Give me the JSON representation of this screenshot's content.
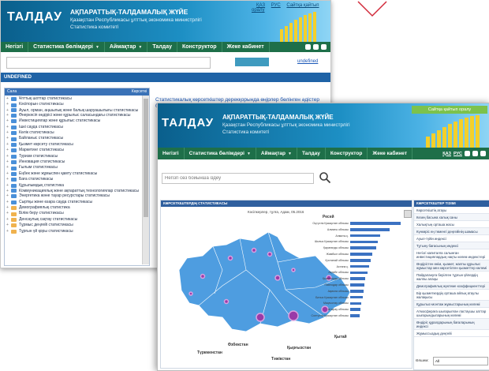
{
  "back": {
    "logo": "ТАЛДАУ",
    "title": "АҚПАРАТТЫҚ-ТАЛДАМАЛЫҚ ЖҮЙЕ",
    "subtitle_line1": "Қазақстан Республикасы ұлттық экономика министрлігі",
    "subtitle_line2": "Статистика комитеті",
    "top_links": [
      "ҚАЗ",
      "РУС",
      "Сайтқа қайтып оралу"
    ],
    "nav": [
      {
        "label": "Негізгі",
        "caret": false
      },
      {
        "label": "Статистика бөлімдері",
        "caret": true
      },
      {
        "label": "Аймақтар",
        "caret": true
      },
      {
        "label": "Талдау",
        "caret": false
      },
      {
        "label": "Конструктор",
        "caret": false
      },
      {
        "label": "Жеке кабинет",
        "caret": false
      }
    ],
    "search_link": "undefined",
    "section": "UNDEFINED",
    "tree_header_left": "Сала",
    "tree_header_right": "Көрсеткі",
    "tree_items": [
      {
        "label": "Ұлттық шоттар статистикасы",
        "color": "blue"
      },
      {
        "label": "Кәсіпорын статистикасы",
        "color": "blue"
      },
      {
        "label": "Ауыл, орман, аңшылық және балық шаруашылығы статистикасы",
        "color": "blue",
        "wrap": true
      },
      {
        "label": "Өнеркәсіп өндірісі және құрылыс саласындағы статистикасы",
        "color": "blue"
      },
      {
        "label": "Инвестициялар және құрылыс статистикасы",
        "color": "blue"
      },
      {
        "label": "Ішкі сауда статистикасы",
        "color": "blue"
      },
      {
        "label": "Көлік статистикасы",
        "color": "blue"
      },
      {
        "label": "Байланыс статистикасы",
        "color": "blue"
      },
      {
        "label": "Қызмет көрсету статистикасы",
        "color": "blue"
      },
      {
        "label": "Маркетинг статистикасы",
        "color": "blue"
      },
      {
        "label": "Туризм статистикасы",
        "color": "blue"
      },
      {
        "label": "Инновация статистикасы",
        "color": "blue"
      },
      {
        "label": "Ғылым статистикасы",
        "color": "blue"
      },
      {
        "label": "Еңбек және жұмыспен қамту статистикасы",
        "color": "blue"
      },
      {
        "label": "Баға статистикасы",
        "color": "blue"
      },
      {
        "label": "Құрылымдық статистика",
        "color": "blue"
      },
      {
        "label": "Коммуникациялық және ақпараттық технологиялар статистикасы",
        "color": "blue",
        "wrap": true
      },
      {
        "label": "Энергетика және тауар ресурстары статистикасы",
        "color": "blue"
      },
      {
        "label": "Сыртқы және өзара сауда статистикасы",
        "color": "blue"
      },
      {
        "label": "Демографиялық статистика",
        "color": "orange"
      },
      {
        "label": "Білім беру статистикасы",
        "color": "orange"
      },
      {
        "label": "Денсаулық сақтау статистикасы",
        "color": "orange"
      },
      {
        "label": "Тұрмыс деңгейі статистикасы",
        "color": "orange"
      },
      {
        "label": "Тұрғын үй қоры статистикасы",
        "color": "orange"
      }
    ],
    "info_text": "Статистикалық көрсеткіштер дерекқорында өңірлер бөлінген әдістер бойынша деректер жоқ"
  },
  "front": {
    "logo": "ТАЛДАУ",
    "title": "АҚПАРАТТЫҚ-ТАЛДАМАЛЫҚ ЖҮЙЕ",
    "subtitle_line1": "Қазақстан Республикасы ұлттық экономика министрлігі",
    "subtitle_line2": "Статистика комитеті",
    "top_link": "Сайтқа қайтып оралу",
    "lang_links": [
      "ҚАЗ",
      "РУС"
    ],
    "nav": [
      {
        "label": "Негізгі",
        "caret": false
      },
      {
        "label": "Статистика бөлімдері",
        "caret": true
      },
      {
        "label": "Аймақтар",
        "caret": true
      },
      {
        "label": "Талдау",
        "caret": false
      },
      {
        "label": "Конструктор",
        "caret": false
      },
      {
        "label": "Жеке кабинет",
        "caret": false
      }
    ],
    "search_placeholder": "Негізгі сөз бойынша іздеу",
    "map_panel_title": "КӨРСЕТКІШТЕРДІҢ СТАТИСТИКАСЫ",
    "chart_title": "Кәсіпкерлер, тұлға, Адам, 05.2016",
    "map_labels": {
      "russia": "Ресей",
      "uzbekistan": "Өзбекстан",
      "turkmenistan": "Түркменстан",
      "kyrgyzstan": "Қырғызстан",
      "china": "Қытай",
      "tajikistan": "Тәжікстан"
    },
    "bar_regions": [
      "Оңтүстік Қазақстан облысы",
      "Алматы облысы",
      "Алматы қ.",
      "Шығыс Қазақстан облысы",
      "Қарағанды облысы",
      "Жамбыл облысы",
      "Қостанай облысы",
      "Астана қ.",
      "Ақтөбе облысы",
      "Қызылорда облысы",
      "Павлодар облысы",
      "Ақмола облысы",
      "Батыс Қазақстан облысы",
      "Маңғыстау облысы",
      "Атырау облысы",
      "Солтүстік Қазақстан облысы"
    ],
    "bar_values": [
      100,
      78,
      60,
      55,
      52,
      44,
      40,
      37,
      35,
      30,
      28,
      27,
      25,
      22,
      20,
      18
    ],
    "indicator_panel_title": "КӨРСЕТКІШТЕР ТІЗІМІ",
    "indicators": [
      "Көрсеткіштің атауы",
      "Кезең басына халық саны",
      "Халықтың орташа жасы",
      "Күнкөріс ең төменгі деңгейінің шамасы",
      "Ауыл-түйін индексі",
      "Тұтыну бағасының индексі",
      "Негізгі капиталға салынған инвестициялардың нақты көлем индекстері",
      "Өндірістен өнім, қызмет, жалпы құрылыс жұмыстар мен көрсетілген қызметтер көлемі",
      "Пайдалануға берілген тұрғын үйлердің жалпы алаңы",
      "Демографиялық жүктеме коэффициенттері",
      "Бір қызметкердің орташа айлық атаулы жалақысы",
      "Құрылыс-монтаж жұмыстарының көлемі",
      "Атмосфераға шығарылған ластаушы заттар шығарындыларының көлемі",
      "Өндіріс құралдарының бағаларының индексі",
      "Жұмыссыздық деңгейі"
    ],
    "filter_label": "Өлшем:",
    "filter_value": "All"
  }
}
